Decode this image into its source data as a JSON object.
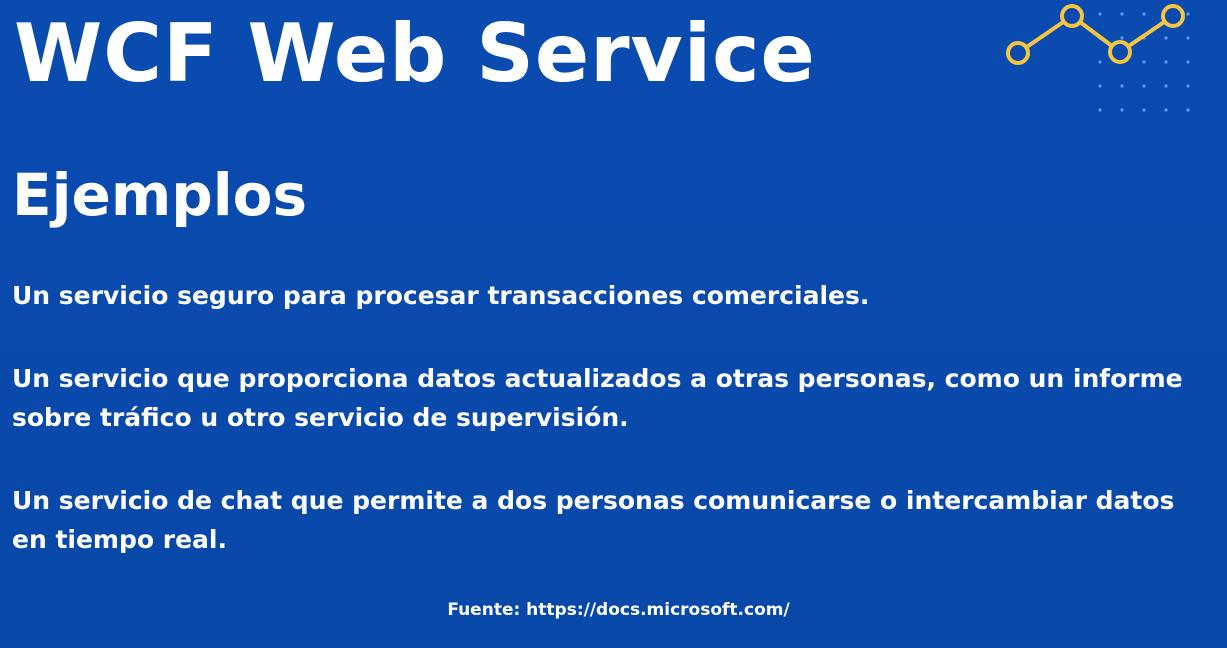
{
  "slide": {
    "title": "WCF Web Service",
    "subtitle": "Ejemplos",
    "bullets": [
      "Un servicio seguro para procesar transacciones comerciales.",
      "Un servicio que proporciona datos actualizados a otras personas, como un informe sobre tráfico u otro servicio de supervisión.",
      "Un servicio de chat que permite a dos personas comunicarse o intercambiar datos en tiempo real."
    ],
    "source": "Fuente: https://docs.microsoft.com/"
  },
  "decoration": {
    "icon": "line-chart-icon",
    "line_color": "#f5c542",
    "dot_color": "#5b9cf0"
  },
  "colors": {
    "background": "#0a4aad",
    "text": "#ffffff"
  }
}
